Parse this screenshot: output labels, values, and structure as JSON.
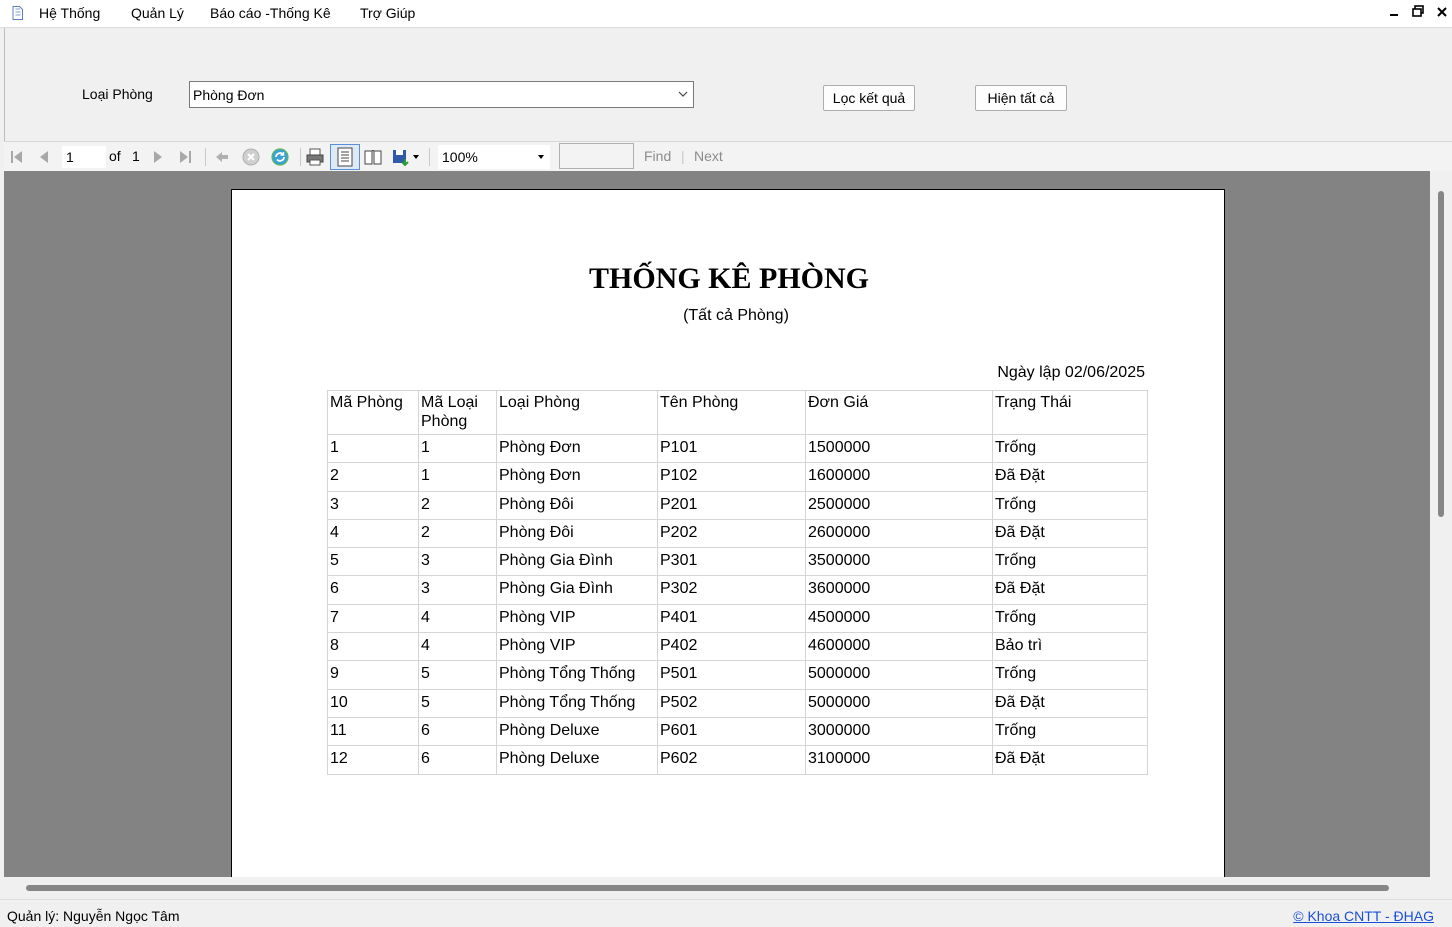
{
  "menu": {
    "items": [
      "Hệ Thống",
      "Quản Lý",
      "Báo cáo -Thống Kê",
      "Trợ Giúp"
    ]
  },
  "window_controls": {
    "minimize": "▁",
    "restore": "❐",
    "close": "✕"
  },
  "filter": {
    "label": "Loại Phòng",
    "selected": "Phòng Đơn",
    "filter_button": "Lọc kết quả",
    "show_all_button": "Hiện tất cả"
  },
  "toolbar": {
    "current_page": "1",
    "of_label": "of",
    "total_pages": "1",
    "zoom": "100%",
    "find_label": "Find",
    "separator": "|",
    "next_label": "Next",
    "icons": [
      "first-page-icon",
      "previous-page-icon",
      "next-page-icon",
      "last-page-icon",
      "back-icon",
      "stop-icon",
      "refresh-icon",
      "print-icon",
      "print-layout-icon",
      "page-setup-icon",
      "export-icon"
    ]
  },
  "report": {
    "title": "THỐNG KÊ PHÒNG",
    "subtitle": "(Tất cả Phòng)",
    "date": "Ngày lập 02/06/2025",
    "columns": [
      "Mã Phòng",
      "Mã Loại Phòng",
      "Loại Phòng",
      "Tên Phòng",
      "Đơn Giá",
      "Trạng Thái"
    ],
    "rows": [
      [
        "1",
        "1",
        "Phòng Đơn",
        "P101",
        "1500000",
        "Trống"
      ],
      [
        "2",
        "1",
        "Phòng Đơn",
        "P102",
        "1600000",
        "Đã Đặt"
      ],
      [
        "3",
        "2",
        "Phòng Đôi",
        "P201",
        "2500000",
        "Trống"
      ],
      [
        "4",
        "2",
        "Phòng Đôi",
        "P202",
        "2600000",
        "Đã Đặt"
      ],
      [
        "5",
        "3",
        "Phòng Gia Đình",
        "P301",
        "3500000",
        "Trống"
      ],
      [
        "6",
        "3",
        "Phòng Gia Đình",
        "P302",
        "3600000",
        "Đã Đặt"
      ],
      [
        "7",
        "4",
        "Phòng VIP",
        "P401",
        "4500000",
        "Trống"
      ],
      [
        "8",
        "4",
        "Phòng VIP",
        "P402",
        "4600000",
        "Bảo trì"
      ],
      [
        "9",
        "5",
        "Phòng Tổng Thống",
        "P501",
        "5000000",
        "Trống"
      ],
      [
        "10",
        "5",
        "Phòng Tổng Thống",
        "P502",
        "5000000",
        "Đã Đặt"
      ],
      [
        "11",
        "6",
        "Phòng Deluxe",
        "P601",
        "3000000",
        "Trống"
      ],
      [
        "12",
        "6",
        "Phòng Deluxe",
        "P602",
        "3100000",
        "Đã Đặt"
      ]
    ]
  },
  "status": {
    "manager": "Quản lý: Nguyễn Ngọc Tâm",
    "credit": "© Khoa CNTT - ĐHAG"
  }
}
